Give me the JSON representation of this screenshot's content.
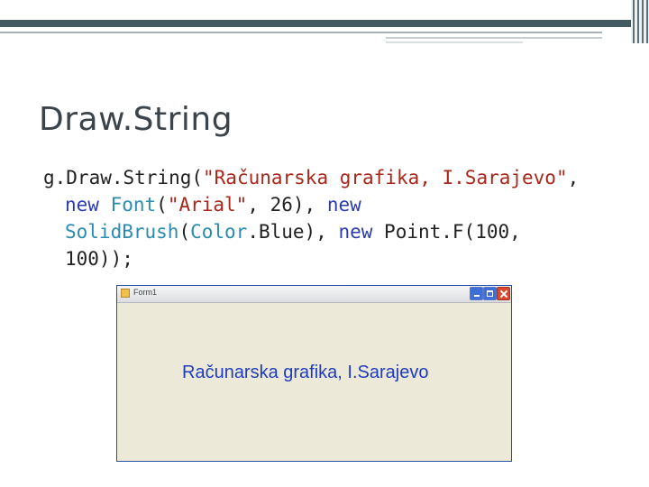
{
  "slide": {
    "title": "Draw.String"
  },
  "code": {
    "line1_a": "g.Draw.String(",
    "line1_str": "\"Računarska grafika, I.Sarajevo\"",
    "line1_b": ",",
    "line2_new": "new",
    "line2_type": "Font",
    "line2_a": "(",
    "line2_str": "\"Arial\"",
    "line2_b": ", 26), ",
    "line2_new2": "new",
    "line3_type": "SolidBrush",
    "line3_a": "(",
    "line3_type2": "Color",
    "line3_b": ".Blue), ",
    "line3_new": "new",
    "line3_c": " Point.F(100,",
    "line4": "100));"
  },
  "form": {
    "title": "Form1",
    "drawn_text": "Računarska grafika, I.Sarajevo"
  },
  "colors": {
    "keyword": "#2b3cb0",
    "string": "#a8261a",
    "type": "#2b8bb0",
    "drawn_text": "#1f3cbf"
  }
}
